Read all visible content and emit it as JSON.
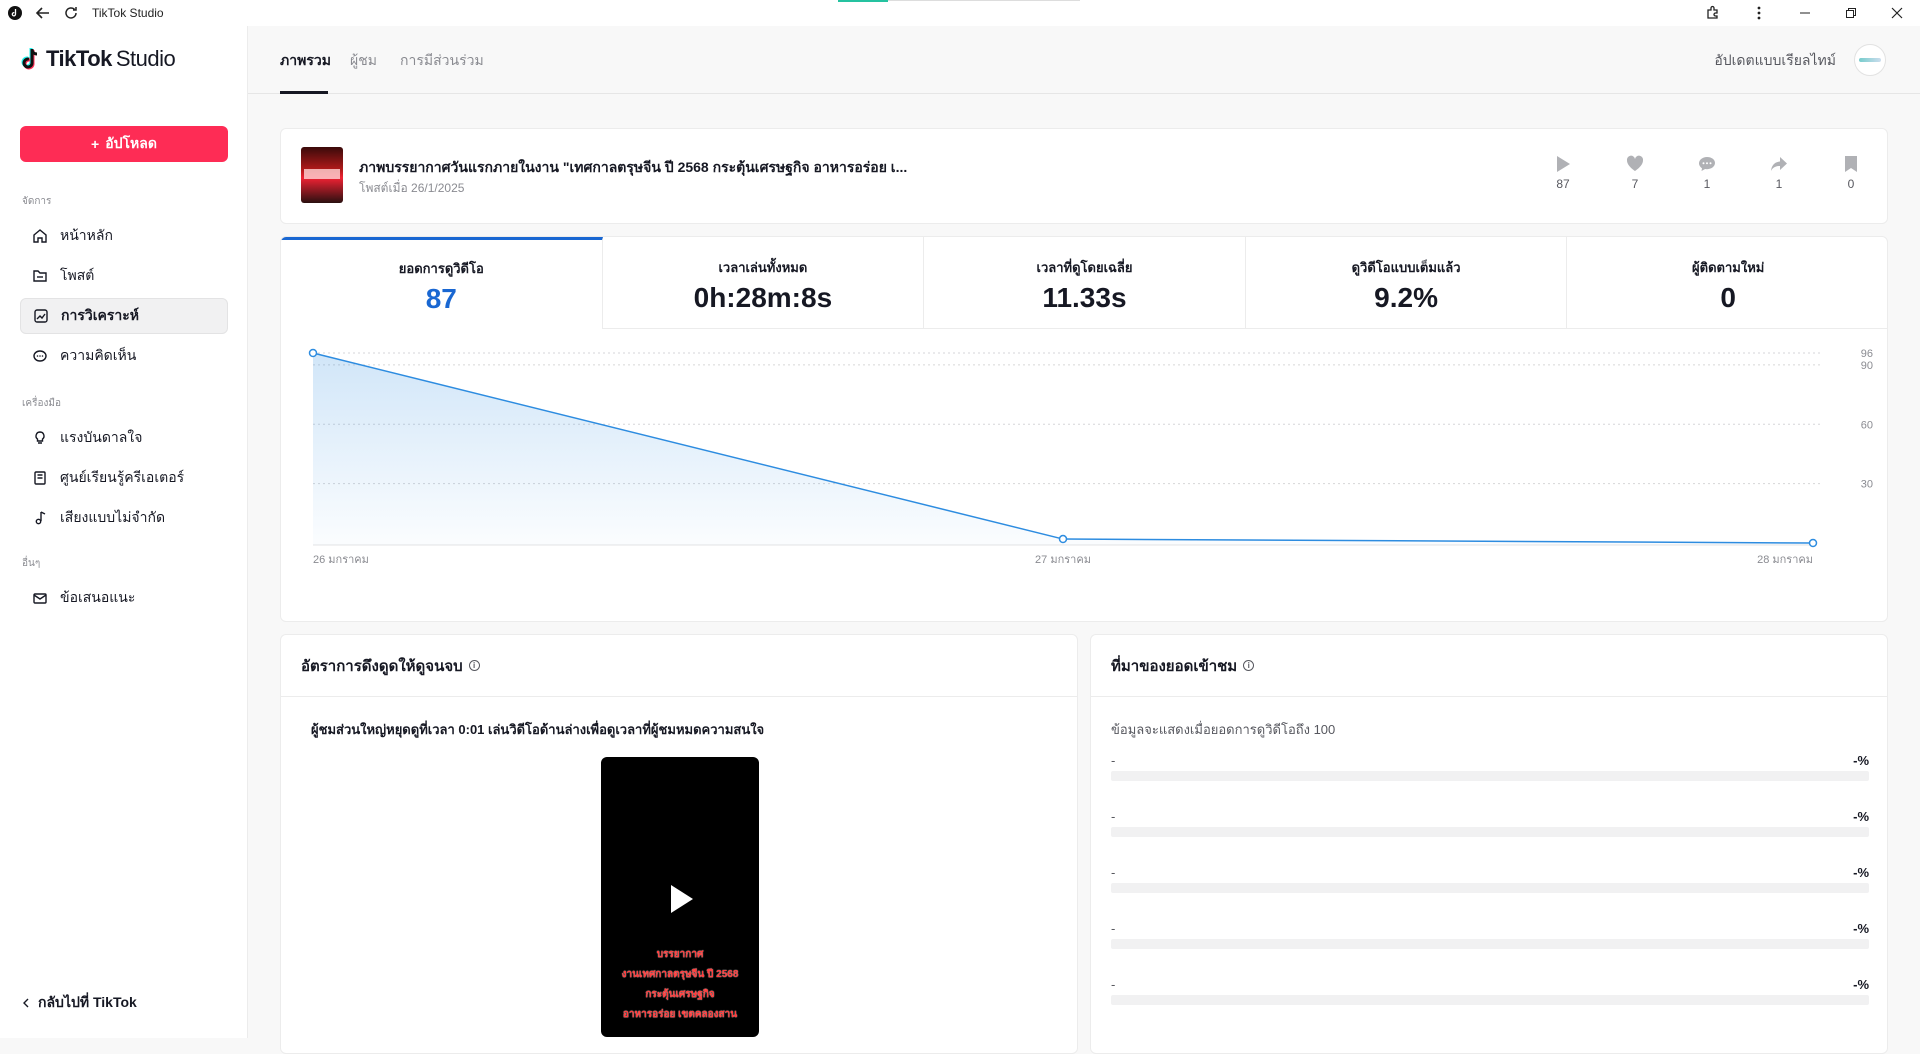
{
  "window": {
    "title": "TikTok Studio"
  },
  "sidebar": {
    "logo_brand": "TikTok",
    "logo_suffix": "Studio",
    "upload_label": "อัปโหลด",
    "sections": [
      {
        "label": "จัดการ",
        "items": [
          {
            "label": "หน้าหลัก",
            "icon": "home-icon"
          },
          {
            "label": "โพสต์",
            "icon": "folder-icon"
          },
          {
            "label": "การวิเคราะห์",
            "icon": "analytics-icon",
            "active": true
          },
          {
            "label": "ความคิดเห็น",
            "icon": "comment-icon"
          }
        ]
      },
      {
        "label": "เครื่องมือ",
        "items": [
          {
            "label": "แรงบันดาลใจ",
            "icon": "lightbulb-icon"
          },
          {
            "label": "ศูนย์เรียนรู้ครีเอเตอร์",
            "icon": "book-icon"
          },
          {
            "label": "เสียงแบบไม่จำกัด",
            "icon": "music-icon"
          }
        ]
      },
      {
        "label": "อื่นๆ",
        "items": [
          {
            "label": "ข้อเสนอแนะ",
            "icon": "mail-icon"
          }
        ]
      }
    ],
    "back_label": "กลับไปที่ TikTok"
  },
  "topbar": {
    "tabs": [
      "ภาพรวม",
      "ผู้ชม",
      "การมีส่วนร่วม"
    ],
    "active_tab": 0,
    "realtime_label": "อัปเดตแบบเรียลไทม์"
  },
  "post": {
    "title": "ภาพบรรยากาศวันแรกภายในงาน \"เทศกาลตรุษจีน ปี 2568 กระตุ้นเศรษฐกิจ อาหารอร่อย เ...",
    "date": "โพสต์เมื่อ 26/1/2025",
    "stats": {
      "plays": "87",
      "likes": "7",
      "comments": "1",
      "shares": "1",
      "saves": "0"
    }
  },
  "metrics": [
    {
      "label": "ยอดการดูวิดีโอ",
      "value": "87",
      "active": true
    },
    {
      "label": "เวลาเล่นทั้งหมด",
      "value": "0h:28m:8s"
    },
    {
      "label": "เวลาที่ดูโดยเฉลี่ย",
      "value": "11.33s"
    },
    {
      "label": "ดูวิดีโอแบบเต็มแล้ว",
      "value": "9.2%"
    },
    {
      "label": "ผู้ติดตามใหม่",
      "value": "0"
    }
  ],
  "chart_data": {
    "type": "area",
    "categories": [
      "26 มกราคม",
      "27 มกราคม",
      "28 มกราคม"
    ],
    "values": [
      96,
      2,
      0
    ],
    "y_ticks": [
      30,
      60,
      90,
      96
    ],
    "ylim": [
      0,
      96
    ],
    "color": "#2d8ce0",
    "grid": true
  },
  "retention": {
    "title": "อัตราการดึงดูดให้ดูจนจบ",
    "text": "ผู้ชมส่วนใหญ่หยุดดูที่เวลา 0:01 เล่นวิดีโอด้านล่างเพื่อดูเวลาที่ผู้ชมหมดความสนใจ",
    "video_caption": [
      "บรรยากาศ",
      "งานเทศกาลตรุษจีน ปี 2568",
      "กระตุ้นเศรษฐกิจ",
      "อาหารอร่อย เขตคลองสาน"
    ]
  },
  "sources": {
    "title": "ที่มาของยอดเข้าชม",
    "note": "ข้อมูลจะแสดงเมื่อยอดการดูวิดีโอถึง 100",
    "rows": [
      {
        "name": "-",
        "pct": "-%"
      },
      {
        "name": "-",
        "pct": "-%"
      },
      {
        "name": "-",
        "pct": "-%"
      },
      {
        "name": "-",
        "pct": "-%"
      },
      {
        "name": "-",
        "pct": "-%"
      }
    ]
  }
}
